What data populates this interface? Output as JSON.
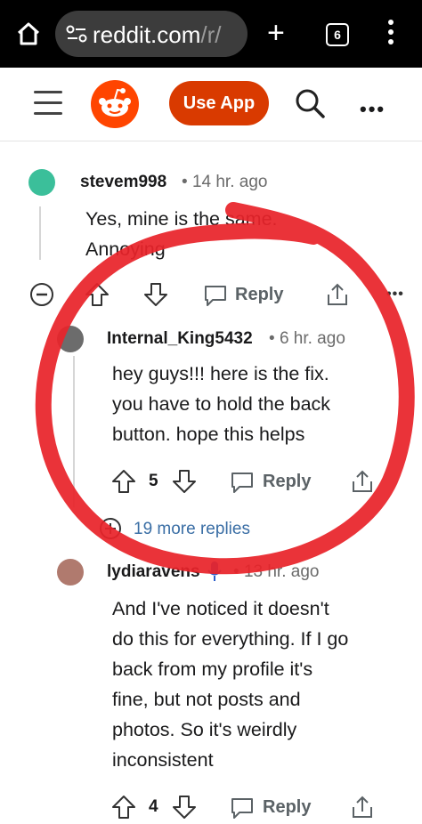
{
  "browser": {
    "url_main": "reddit.com",
    "url_suffix": "/r/",
    "tab_count": "6"
  },
  "header": {
    "use_app_label": "Use App"
  },
  "comments": [
    {
      "username": "stevem998",
      "time": "14 hr. ago",
      "lines": [
        "Yes, mine is the same.",
        "Annoying"
      ],
      "reply_label": "Reply"
    },
    {
      "username": "Internal_King5432",
      "time": "6 hr. ago",
      "lines": [
        "hey guys!!! here is the fix.",
        "you have to hold the back",
        "button. hope this helps"
      ],
      "votes": "5",
      "reply_label": "Reply",
      "more_replies": "19 more replies"
    },
    {
      "username": "lydiaravens",
      "time": "13 hr. ago",
      "lines": [
        "And I've noticed it doesn't",
        "do this for everything. If I go",
        "back from my profile it's",
        "fine, but not posts and",
        "photos. So it's weirdly",
        "inconsistent"
      ],
      "votes": "4",
      "reply_label": "Reply"
    }
  ],
  "colors": {
    "annotation": "#e8232a",
    "brand": "#ff4500",
    "use_app": "#d93a00"
  }
}
